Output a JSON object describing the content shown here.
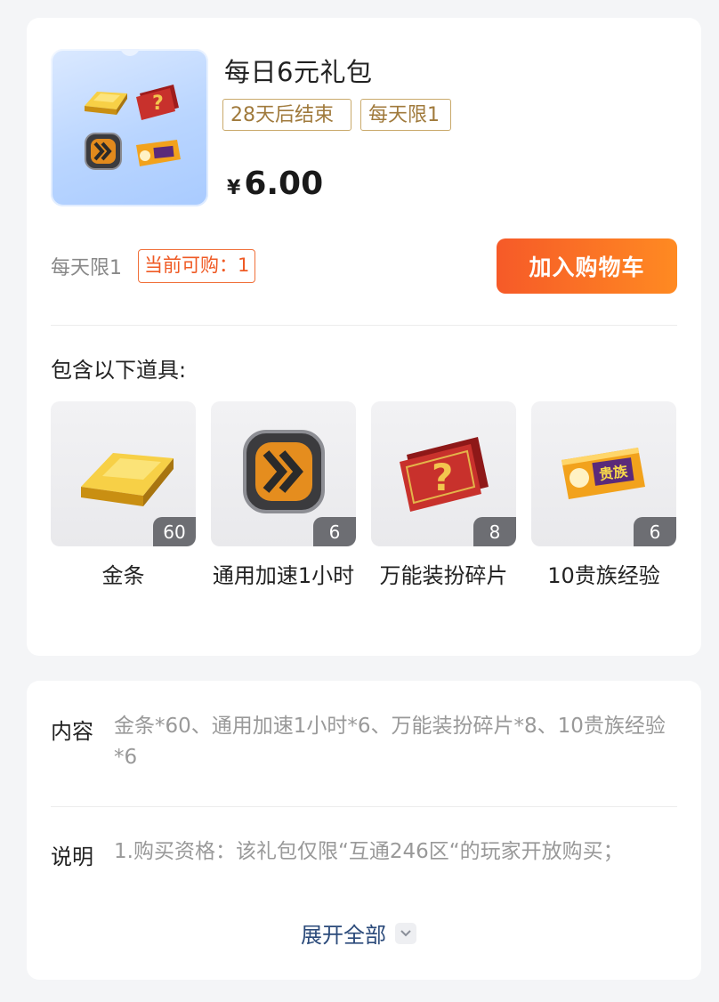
{
  "package": {
    "title": "每日6元礼包",
    "tags": [
      "28天后结束",
      "每天限1"
    ],
    "currency": "¥",
    "price": "6.00",
    "limit_text": "每天限1",
    "can_buy_text": "当前可购：1",
    "cart_button": "加入购物车"
  },
  "items_section": {
    "title": "包含以下道具:",
    "items": [
      {
        "name": "金条",
        "count": "60",
        "icon": "gold-bar-icon"
      },
      {
        "name": "通用加速1小时",
        "count": "6",
        "icon": "speedup-icon"
      },
      {
        "name": "万能装扮碎片",
        "count": "8",
        "icon": "costume-fragment-icon"
      },
      {
        "name": "10贵族经验",
        "count": "6",
        "icon": "noble-exp-card-icon"
      }
    ]
  },
  "details": {
    "content_label": "内容",
    "content_value": "金条*60、通用加速1小时*6、万能装扮碎片*8、10贵族经验*6",
    "desc_label": "说明",
    "desc_value": "1.购买资格：该礼包仅限“互通246区“的玩家开放购买；",
    "expand_label": "展开全部"
  },
  "colors": {
    "accent_orange": "#f65a28",
    "tag_gold": "#c9a96a",
    "link_blue": "#2b4a7a"
  }
}
